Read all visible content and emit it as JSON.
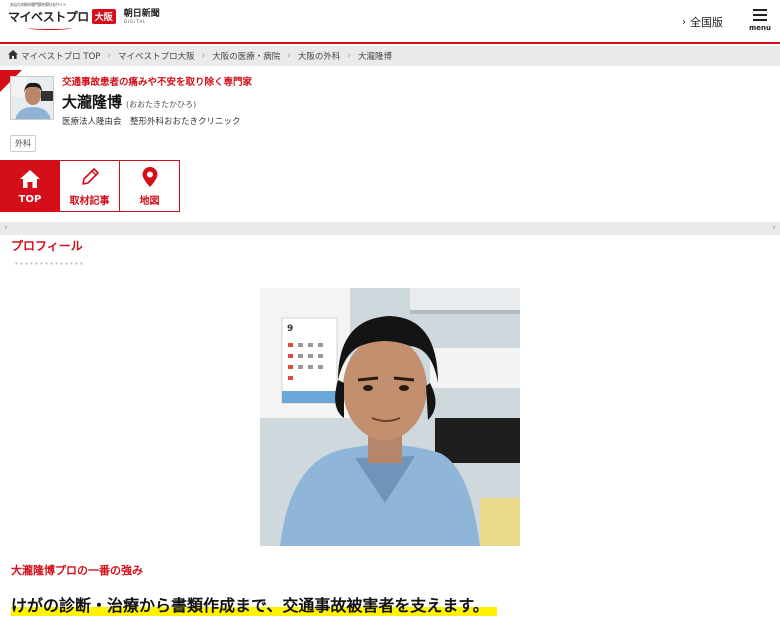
{
  "header": {
    "logo_tagline": "あなたの街の専門家を探せるサイト",
    "logo_text": "マイベストプロ",
    "logo_badge": "大阪",
    "partner_name": "朝日新聞",
    "partner_sub": "DIGITAL",
    "national_link": "全国版",
    "menu_label": "menu"
  },
  "breadcrumb": {
    "items": [
      "マイベストプロ TOP",
      "マイベストプロ大阪",
      "大阪の医療・病院",
      "大阪の外科",
      "大瀧隆博"
    ]
  },
  "profile": {
    "tagline": "交通事故患者の痛みや不安を取り除く専門家",
    "name": "大瀧隆博",
    "reading": "(おおたきたかひろ)",
    "clinic": "医療法人隆由会　整形外科おおたきクリニック",
    "category_tag": "外科"
  },
  "tabs": [
    {
      "label": "TOP",
      "icon": "home-icon",
      "active": true
    },
    {
      "label": "取材記事",
      "icon": "pencil-icon",
      "active": false
    },
    {
      "label": "地図",
      "icon": "map-pin-icon",
      "active": false
    }
  ],
  "scroller": {
    "left": "‹",
    "right": "›"
  },
  "section": {
    "title": "プロフィール",
    "strength_label": "大瀧隆博プロの一番の強み",
    "headline": "けがの診断・治療から書類作成まで、交通事故被害者を支えます。"
  },
  "photo": {
    "calendar_month": "9"
  },
  "colors": {
    "accent": "#d40f19",
    "highlight": "#fff200",
    "breadcrumb_bg": "#eaeaea"
  }
}
